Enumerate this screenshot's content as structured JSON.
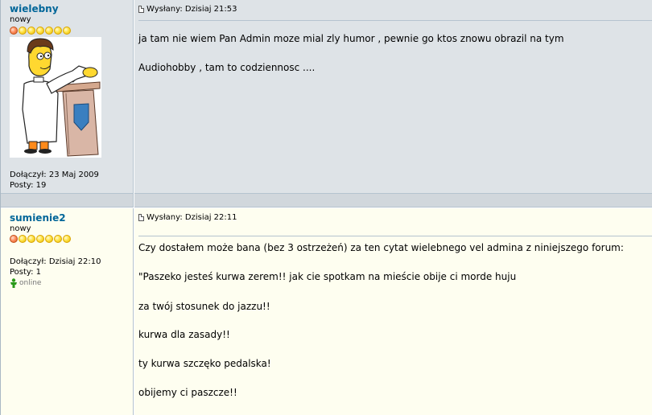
{
  "posts": [
    {
      "username": "wielebny",
      "rank": "nowy",
      "joined": "Dołączył: 23 Maj 2009",
      "post_count": "Posty: 19",
      "posted": "Wysłany: Dzisiaj 21:53",
      "lines": [
        "ja tam nie wiem Pan Admin moze mial zly humor , pewnie go ktos znowu obrazil na tym",
        "Audiohobby , tam to codziennosc ...."
      ]
    },
    {
      "username": "sumienie2",
      "rank": "nowy",
      "joined": "Dołączył: Dzisiaj 22:10",
      "post_count": "Posty: 1",
      "status": "online",
      "posted": "Wysłany: Dzisiaj 22:11",
      "lines": [
        "Czy dostałem może bana (bez 3 ostrzeżeń) za ten cytat wielebnego vel admina z niniejszego forum:",
        "\"Paszeko jesteś kurwa zerem!! jak cie spotkam na mieście obije ci morde huju",
        "za twój stosunek do jazzu!!",
        "kurwa dla zasady!!",
        "ty kurwa szczęko pedalska!",
        "obijemy ci paszcze!!"
      ]
    }
  ]
}
